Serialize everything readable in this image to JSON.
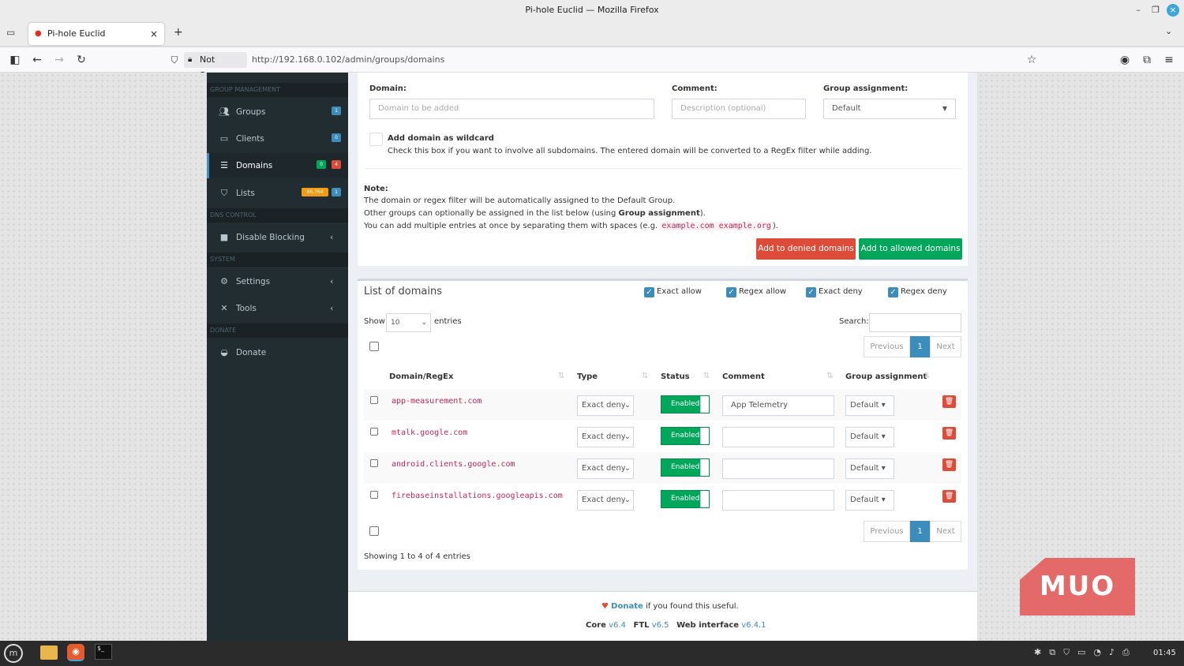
{
  "window": {
    "title": "Pi-hole Euclid — Mozilla Firefox"
  },
  "tab": {
    "label": "Pi-hole Euclid",
    "close": "×",
    "new": "+"
  },
  "navbar": {
    "not_secure": "Not Secure",
    "url": "http://192.168.0.102/admin/groups/domains"
  },
  "sidebar": {
    "headers": [
      "GROUP MANAGEMENT",
      "DNS CONTROL",
      "SYSTEM",
      "DONATE"
    ],
    "items": [
      {
        "label": "Groups",
        "badge": "1"
      },
      {
        "label": "Clients",
        "badge": "0"
      },
      {
        "label": "Domains",
        "badge_green": "0",
        "badge_red": "4"
      },
      {
        "label": "Lists",
        "badge_orange": "86,764",
        "badge": "1"
      },
      {
        "label": "Disable Blocking"
      },
      {
        "label": "Settings"
      },
      {
        "label": "Tools"
      },
      {
        "label": "Donate"
      }
    ]
  },
  "form": {
    "domain_label": "Domain:",
    "domain_placeholder": "Domain to be added",
    "comment_label": "Comment:",
    "comment_placeholder": "Description (optional)",
    "group_label": "Group assignment:",
    "group_value": "Default",
    "wildcard_label": "Add domain as wildcard",
    "wildcard_help": "Check this box if you want to involve all subdomains. The entered domain will be converted to a RegEx filter while adding.",
    "note_title": "Note:",
    "note_line1": "The domain or regex filter will be automatically assigned to the Default Group.",
    "note_line2_a": "Other groups can optionally be assigned in the list below (using ",
    "note_line2_b": "Group assignment",
    "note_line2_c": ").",
    "note_line3_a": "You can add multiple entries at once by separating them with spaces (e.g. ",
    "note_line3_code": "example.com example.org",
    "note_line3_c": ").",
    "btn_deny": "Add to denied domains",
    "btn_allow": "Add to allowed domains"
  },
  "list": {
    "title": "List of domains",
    "filters": [
      "Exact allow",
      "Regex allow",
      "Exact deny",
      "Regex deny"
    ],
    "show": "Show",
    "entries_value": "10",
    "entries": "entries",
    "search": "Search:",
    "prev": "Previous",
    "page": "1",
    "next": "Next",
    "columns": [
      "Domain/RegEx",
      "Type",
      "Status",
      "Comment",
      "Group assignment"
    ],
    "rows": [
      {
        "domain": "app-measurement.com",
        "type": "Exact deny",
        "status": "Enabled",
        "comment": "App Telemetry",
        "group": "Default"
      },
      {
        "domain": "mtalk.google.com",
        "type": "Exact deny",
        "status": "Enabled",
        "comment": "",
        "group": "Default"
      },
      {
        "domain": "android.clients.google.com",
        "type": "Exact deny",
        "status": "Enabled",
        "comment": "",
        "group": "Default"
      },
      {
        "domain": "firebaseinstallations.googleapis.com",
        "type": "Exact deny",
        "status": "Enabled",
        "comment": "",
        "group": "Default"
      }
    ],
    "showing": "Showing 1 to 4 of 4 entries"
  },
  "footer": {
    "donate": "Donate",
    "donate_rest": " if you found this useful.",
    "core": "Core",
    "core_v": "v6.4",
    "ftl": "FTL",
    "ftl_v": "v6.5",
    "web": "Web interface",
    "web_v": "v6.4.1"
  },
  "taskbar": {
    "time": "01:45"
  },
  "watermark": "MUO",
  "colors": {
    "sidebar": "#222d32",
    "accent": "#3c8dbc",
    "danger": "#dd4b39",
    "success": "#00a65a"
  }
}
